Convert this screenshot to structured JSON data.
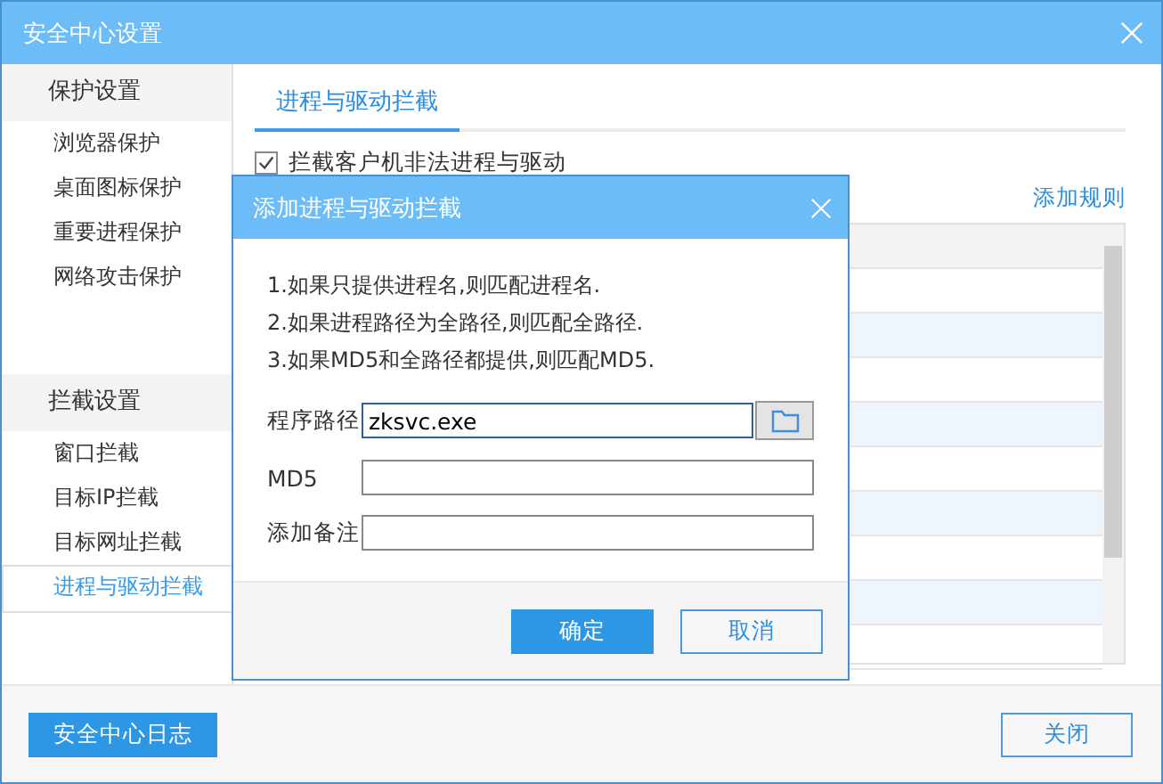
{
  "window": {
    "title": "安全中心设置"
  },
  "sidebar": {
    "groups": [
      {
        "title": "保护设置",
        "items": [
          {
            "label": "浏览器保护",
            "selected": false
          },
          {
            "label": "桌面图标保护",
            "selected": false
          },
          {
            "label": "重要进程保护",
            "selected": false
          },
          {
            "label": "网络攻击保护",
            "selected": false
          }
        ]
      },
      {
        "title": "拦截设置",
        "items": [
          {
            "label": "窗口拦截",
            "selected": false
          },
          {
            "label": "目标IP拦截",
            "selected": false
          },
          {
            "label": "目标网址拦截",
            "selected": false
          },
          {
            "label": "进程与驱动拦截",
            "selected": true
          }
        ]
      }
    ]
  },
  "tabs": [
    {
      "label": "进程与驱动拦截",
      "selected": true
    }
  ],
  "block_option": {
    "label": "拦截客户机非法进程与驱动",
    "checked": true
  },
  "add_rule_link": "添加规则",
  "dialog": {
    "title": "添加进程与驱动拦截",
    "notes": [
      "1.如果只提供进程名,则匹配进程名.",
      "2.如果进程路径为全路径,则匹配全路径.",
      "3.如果MD5和全路径都提供,则匹配MD5."
    ],
    "fields": [
      {
        "label": "程序路径",
        "value": "zksvc.exe",
        "browse": true
      },
      {
        "label": "MD5",
        "browse": false
      },
      {
        "label": "添加备注",
        "browse": false
      }
    ],
    "buttons": [
      {
        "label": "确定",
        "kind": "primary"
      },
      {
        "label": "取消",
        "kind": "secondary"
      }
    ]
  },
  "footer_buttons": [
    {
      "label": "安全中心日志",
      "kind": "primary"
    },
    {
      "label": "关闭",
      "kind": "secondary"
    }
  ]
}
